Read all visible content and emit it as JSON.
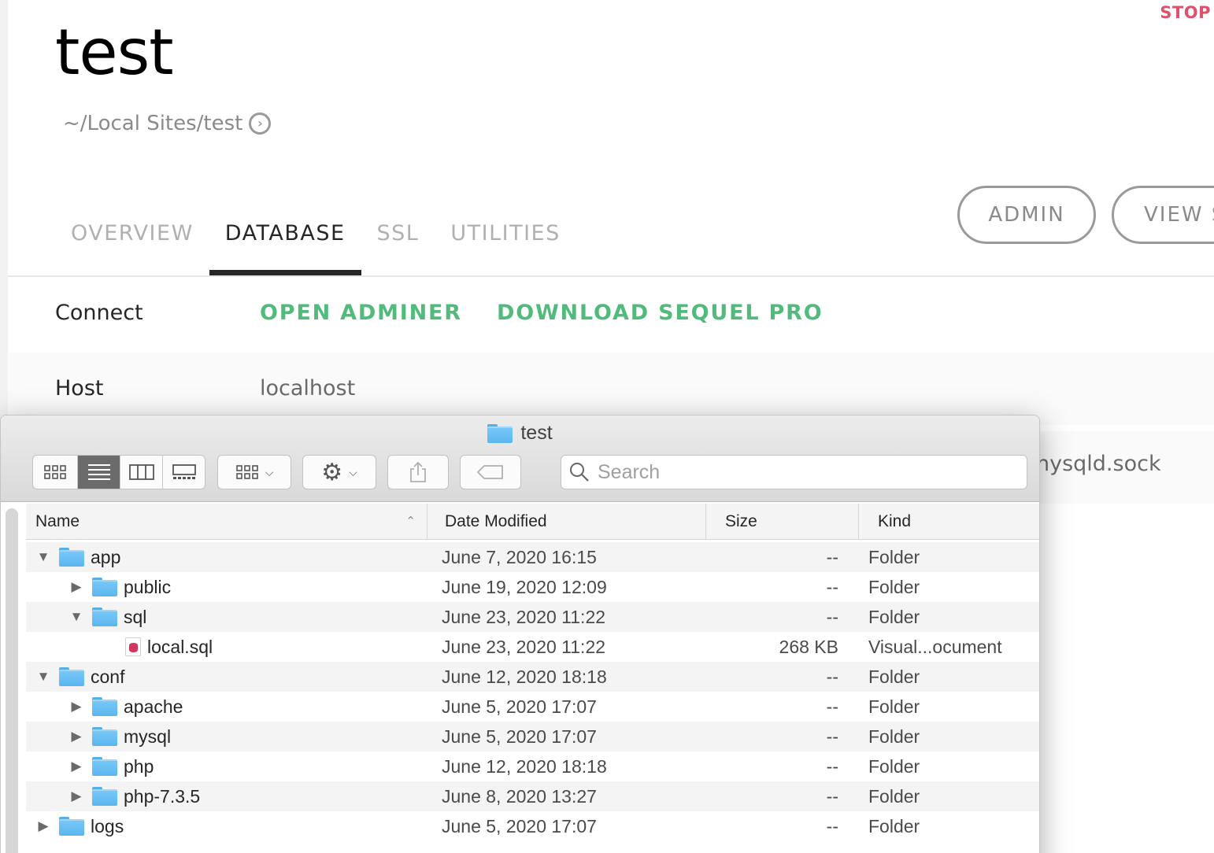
{
  "site": {
    "title": "test",
    "stop_label": "STOP",
    "path": "~/Local Sites/test",
    "tabs": [
      {
        "label": "OVERVIEW",
        "active": false
      },
      {
        "label": "DATABASE",
        "active": true
      },
      {
        "label": "SSL",
        "active": false
      },
      {
        "label": "UTILITIES",
        "active": false
      }
    ],
    "admin_label": "ADMIN",
    "view_label": "VIEW S",
    "connect_label": "Connect",
    "open_adminer": "OPEN ADMINER",
    "download_sequel": "DOWNLOAD SEQUEL PRO",
    "host_label": "Host",
    "host_value": "localhost",
    "socket_value_partial": "nysqld.sock",
    "accent_green": "#51bb7b",
    "stop_color": "#e0506a"
  },
  "finder": {
    "title": "test",
    "title_icon": "folder-icon",
    "search_placeholder": "Search",
    "view_modes": [
      "icon-view",
      "list-view",
      "column-view",
      "gallery-view"
    ],
    "active_view": "list-view",
    "columns": {
      "name": "Name",
      "date": "Date Modified",
      "size": "Size",
      "kind": "Kind"
    },
    "rows": [
      {
        "name": "app",
        "level": 0,
        "disclosure": "expanded",
        "icon": "folder-icon",
        "date": "June 7, 2020 16:15",
        "size": "--",
        "kind": "Folder"
      },
      {
        "name": "public",
        "level": 1,
        "disclosure": "collapsed",
        "icon": "folder-icon",
        "date": "June 19, 2020 12:09",
        "size": "--",
        "kind": "Folder"
      },
      {
        "name": "sql",
        "level": 1,
        "disclosure": "expanded",
        "icon": "folder-icon",
        "date": "June 23, 2020 11:22",
        "size": "--",
        "kind": "Folder"
      },
      {
        "name": "local.sql",
        "level": 2,
        "disclosure": "none",
        "icon": "sql-file-icon",
        "date": "June 23, 2020 11:22",
        "size": "268 KB",
        "kind": "Visual...ocument"
      },
      {
        "name": "conf",
        "level": 0,
        "disclosure": "expanded",
        "icon": "folder-icon",
        "date": "June 12, 2020 18:18",
        "size": "--",
        "kind": "Folder"
      },
      {
        "name": "apache",
        "level": 1,
        "disclosure": "collapsed",
        "icon": "folder-icon",
        "date": "June 5, 2020 17:07",
        "size": "--",
        "kind": "Folder"
      },
      {
        "name": "mysql",
        "level": 1,
        "disclosure": "collapsed",
        "icon": "folder-icon",
        "date": "June 5, 2020 17:07",
        "size": "--",
        "kind": "Folder"
      },
      {
        "name": "php",
        "level": 1,
        "disclosure": "collapsed",
        "icon": "folder-icon",
        "date": "June 12, 2020 18:18",
        "size": "--",
        "kind": "Folder"
      },
      {
        "name": "php-7.3.5",
        "level": 1,
        "disclosure": "collapsed",
        "icon": "folder-icon",
        "date": "June 8, 2020 13:27",
        "size": "--",
        "kind": "Folder"
      },
      {
        "name": "logs",
        "level": 0,
        "disclosure": "collapsed",
        "icon": "folder-icon",
        "date": "June 5, 2020 17:07",
        "size": "--",
        "kind": "Folder"
      }
    ]
  }
}
